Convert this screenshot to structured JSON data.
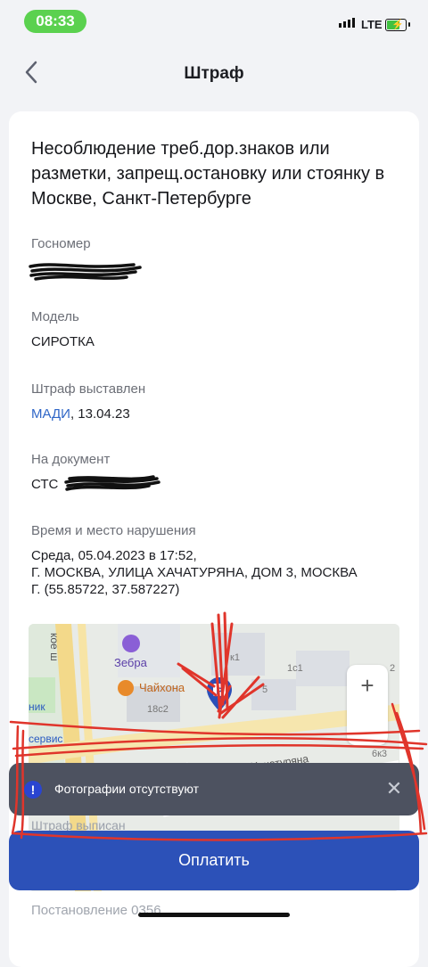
{
  "status": {
    "time": "08:33",
    "network": "LTE"
  },
  "nav": {
    "title": "Штраф"
  },
  "fine": {
    "title": "Несоблюдение треб.дор.знаков или разметки, запрещ.остановку или стоянку в Москве, Санкт-Петербурге",
    "plate_label": "Госномер",
    "model_label": "Модель",
    "model_value": "СИРОТКА",
    "issued_label": "Штраф выставлен",
    "issuer": "МАДИ",
    "issued_date": ", 13.04.23",
    "document_label": "На документ",
    "document_prefix": "СТС",
    "time_place_label": "Время и место нарушения",
    "time_place_line1": "Среда, 05.04.2023 в 17:52,",
    "time_place_line2": "Г. МОСКВА, УЛИЦА ХАЧАТУРЯНА, ДОМ 3, МОСКВА",
    "time_place_line3": "Г. (55.85722, 37.587227)"
  },
  "map": {
    "labels": {
      "zebra": "Зебра",
      "chaihona": "Чайхона",
      "street": "ул. Хачатуряна",
      "b18c2": "18с2",
      "b5": "5",
      "b1c1": "1с1",
      "b6k3": "6к3",
      "bk1": "к1",
      "b2": "2",
      "service": "сервис",
      "nik": "ник",
      "vert_street": "кое ш"
    },
    "zoom_in": "+"
  },
  "toast": {
    "text": "Фотографии отсутствуют",
    "close": "✕",
    "warn": "!"
  },
  "obscured_label": "Штраф выписан",
  "pay_button": "Оплатить",
  "bottom_label": "Постановление 0356"
}
